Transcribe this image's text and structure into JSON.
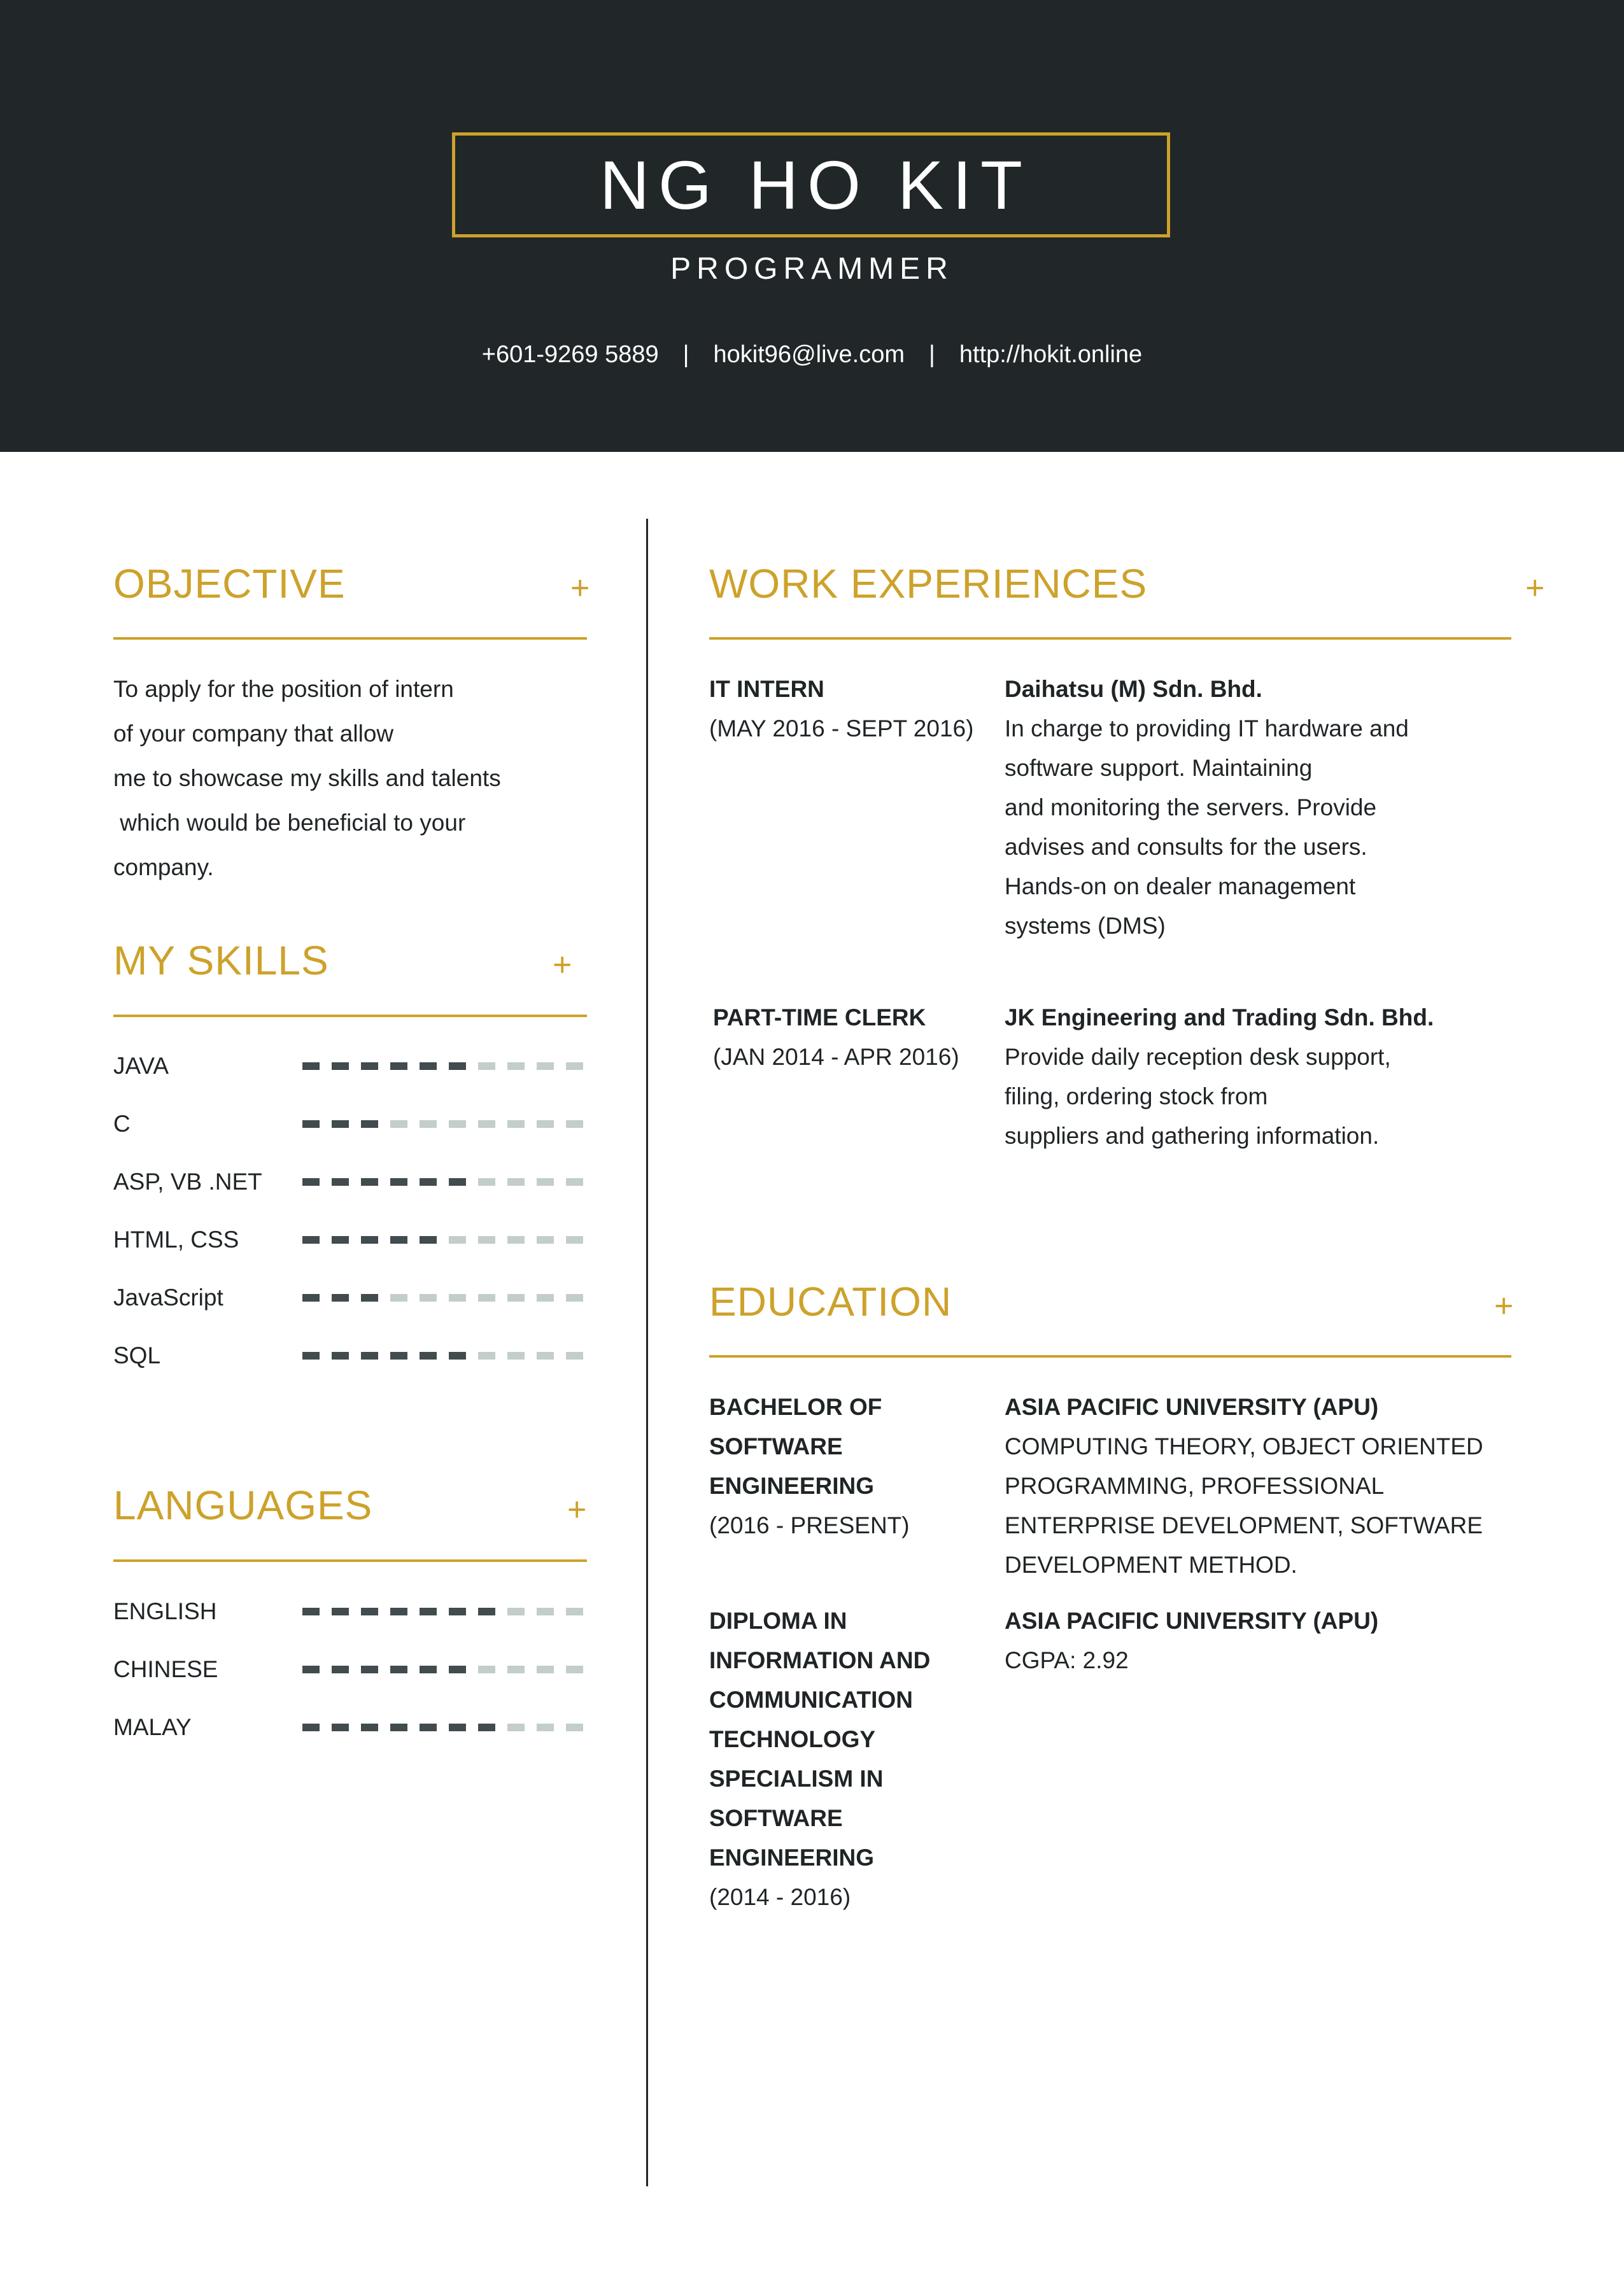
{
  "header": {
    "name": "NG HO KIT",
    "title": "PROGRAMMER",
    "phone": "+601-9269 5889",
    "email": "hokit96@live.com",
    "website": "http://hokit.online",
    "separator": "|"
  },
  "colors": {
    "accent": "#cda22b",
    "header_bg": "#212729",
    "dash_on": "#424b4e",
    "dash_off": "#c3cdcb"
  },
  "objective": {
    "title": "OBJECTIVE",
    "plus": "+",
    "lines": [
      "To apply for the position of intern",
      "of your company that allow",
      "me to showcase my skills and talents",
      " which would be beneficial to your",
      "company."
    ]
  },
  "skills": {
    "title": "MY SKILLS",
    "plus": "+",
    "items": [
      {
        "label": "JAVA",
        "level": 6,
        "max": 10
      },
      {
        "label": "C",
        "level": 3,
        "max": 10
      },
      {
        "label": "ASP, VB .NET",
        "level": 6,
        "max": 10
      },
      {
        "label": "HTML, CSS",
        "level": 5,
        "max": 10
      },
      {
        "label": "JavaScript",
        "level": 3,
        "max": 10
      },
      {
        "label": "SQL",
        "level": 6,
        "max": 10
      }
    ]
  },
  "languages": {
    "title": "LANGUAGES",
    "plus": "+",
    "items": [
      {
        "label": "ENGLISH",
        "level": 7,
        "max": 10
      },
      {
        "label": "CHINESE",
        "level": 6,
        "max": 10
      },
      {
        "label": "MALAY",
        "level": 7,
        "max": 10
      }
    ]
  },
  "work": {
    "title": "WORK EXPERIENCES",
    "plus": "+",
    "entries": [
      {
        "role": "IT INTERN",
        "period": "(MAY 2016 - SEPT 2016)",
        "company": "Daihatsu (M) Sdn. Bhd.",
        "lines": [
          "In charge to providing IT hardware and",
          "software support. Maintaining",
          "and monitoring the servers. Provide",
          "advises and consults for the users.",
          "Hands-on on dealer management",
          "systems (DMS)"
        ]
      },
      {
        "role": "PART-TIME CLERK",
        "period": "(JAN 2014 - APR 2016)",
        "company": "JK Engineering and Trading Sdn. Bhd.",
        "lines": [
          "Provide daily reception desk support,",
          "filing, ordering stock from",
          "suppliers and gathering information."
        ]
      }
    ]
  },
  "education": {
    "title": "EDUCATION",
    "plus": "+",
    "entries": [
      {
        "degree_lines": [
          "BACHELOR OF",
          "SOFTWARE",
          "ENGINEERING"
        ],
        "period": "(2016 - PRESENT)",
        "school": "ASIA PACIFIC UNIVERSITY (APU)",
        "lines": [
          "COMPUTING THEORY, OBJECT ORIENTED",
          "PROGRAMMING, PROFESSIONAL",
          "ENTERPRISE DEVELOPMENT, SOFTWARE",
          "DEVELOPMENT METHOD."
        ]
      },
      {
        "degree_lines": [
          "DIPLOMA IN",
          "INFORMATION AND",
          "COMMUNICATION",
          "TECHNOLOGY",
          "SPECIALISM IN",
          "SOFTWARE",
          "ENGINEERING"
        ],
        "period": "(2014 - 2016)",
        "school": "ASIA PACIFIC UNIVERSITY (APU)",
        "lines": [
          "CGPA: 2.92"
        ]
      }
    ]
  }
}
